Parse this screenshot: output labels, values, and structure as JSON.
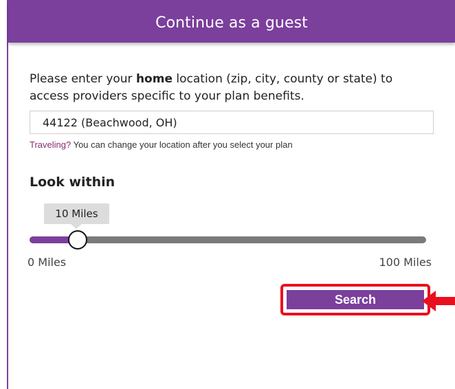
{
  "header": {
    "title": "Continue as a guest"
  },
  "intro": {
    "before": "Please enter your ",
    "bold": "home",
    "after": " location (zip, city, county or state) to access providers specific to your plan benefits."
  },
  "location": {
    "value": "44122 (Beachwood, OH)"
  },
  "travel_note": {
    "link": "Traveling?",
    "text": " You can change your location after you select your plan"
  },
  "radius": {
    "heading": "Look within",
    "tooltip": "10 Miles",
    "value_miles": 10,
    "min_miles": 0,
    "max_miles": 100,
    "min_label": "0 Miles",
    "max_label": "100 Miles"
  },
  "actions": {
    "search_label": "Search"
  },
  "colors": {
    "brand_purple": "#7b3f9c",
    "highlight_red": "#e8101e",
    "track_gray": "#7a7a7a"
  },
  "icons": {
    "annotation": "red-arrow-icon"
  }
}
